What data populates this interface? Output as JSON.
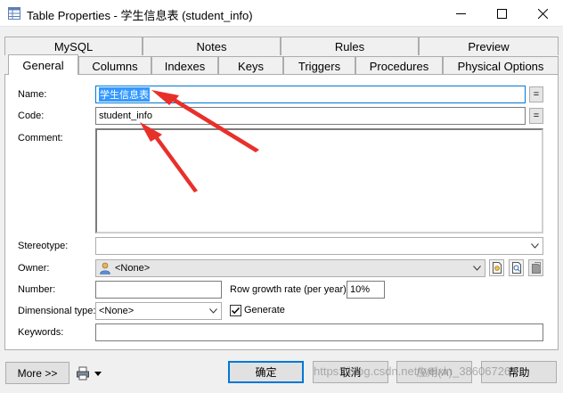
{
  "window": {
    "title": "Table Properties - 学生信息表 (student_info)",
    "icons": [
      "table-icon",
      "minimize-icon",
      "maximize-icon",
      "close-icon"
    ]
  },
  "tabs_top": [
    "MySQL",
    "Notes",
    "Rules",
    "Preview"
  ],
  "tabs_bottom": [
    "General",
    "Columns",
    "Indexes",
    "Keys",
    "Triggers",
    "Procedures",
    "Physical Options"
  ],
  "active_tab": "General",
  "form": {
    "name_label": "Name:",
    "name_value": "学生信息表",
    "code_label": "Code:",
    "code_value": "student_info",
    "comment_label": "Comment:",
    "comment_value": "",
    "equal_button": "=",
    "stereotype_label": "Stereotype:",
    "stereotype_value": "",
    "owner_label": "Owner:",
    "owner_value": "<None>",
    "number_label": "Number:",
    "number_value": "",
    "row_growth_label": "Row growth rate (per year):",
    "row_growth_value": "10%",
    "dimensional_label": "Dimensional type:",
    "dimensional_value": "<None>",
    "generate_label": "Generate",
    "generate_checked": true,
    "keywords_label": "Keywords:",
    "keywords_value": ""
  },
  "buttons": {
    "more": "More >>",
    "ok": "确定",
    "cancel": "取消",
    "apply": "应用(A)",
    "help": "帮助"
  },
  "watermark": "https://blog.csdn.net/weixin_38606726",
  "colors": {
    "selection": "#3399ff",
    "annotation_arrow": "#e8302a",
    "default_button_border": "#0078d7"
  }
}
